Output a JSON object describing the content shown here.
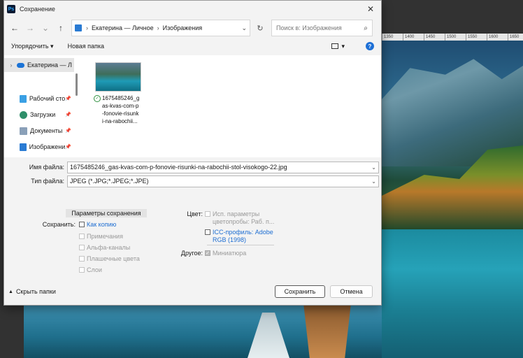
{
  "window": {
    "title": "Сохранение",
    "app_badge": "Ps"
  },
  "nav": {
    "back": "←",
    "forward": "→",
    "recent": "⌄",
    "up": "↑",
    "breadcrumb": [
      "Екатерина — Личное",
      "Изображения"
    ],
    "search_placeholder": "Поиск в: Изображения"
  },
  "toolbar": {
    "organize": "Упорядочить ▾",
    "new_folder": "Новая папка",
    "view": "▾",
    "help": "?"
  },
  "sidebar": {
    "items": [
      {
        "label": "Екатерина — Л",
        "icon": "cloud-icon"
      },
      {
        "label": "Рабочий сто",
        "icon": "desktop-icon"
      },
      {
        "label": "Загрузки",
        "icon": "download-icon"
      },
      {
        "label": "Документы",
        "icon": "documents-icon"
      },
      {
        "label": "Изображени",
        "icon": "pictures-icon"
      }
    ]
  },
  "files": [
    {
      "name_lines": [
        "1675485246_g",
        "as-kvas-com-p",
        "-fonovie-risunk",
        "i-na-rabochii..."
      ],
      "status": "✓"
    }
  ],
  "form": {
    "filename_label": "Имя файла:",
    "filename_value": "1675485246_gas-kvas-com-p-fonovie-risunki-na-rabochii-stol-visokogo-22.jpg",
    "type_label": "Тип файла:",
    "type_value": "JPEG (*.JPG;*.JPEG;*.JPE)"
  },
  "options": {
    "header": "Параметры сохранения",
    "save_label": "Сохранить:",
    "as_copy": "Как копию",
    "notes": "Примечания",
    "alpha": "Альфа-каналы",
    "spot": "Плашечные цвета",
    "layers": "Слои",
    "color_label": "Цвет:",
    "proof_line1": "Исп. параметры",
    "proof_line2": "цветопробы:  Раб. п...",
    "icc_line1": "ICC-профиль:  Adobe",
    "icc_line2": "RGB (1998)",
    "other_label": "Другое:",
    "thumbnail": "Миниатюра"
  },
  "footer": {
    "hide_folders": "Скрыть папки",
    "save": "Сохранить",
    "cancel": "Отмена"
  },
  "ruler": [
    "1350",
    "1400",
    "1450",
    "1500",
    "1550",
    "1600",
    "1650"
  ]
}
